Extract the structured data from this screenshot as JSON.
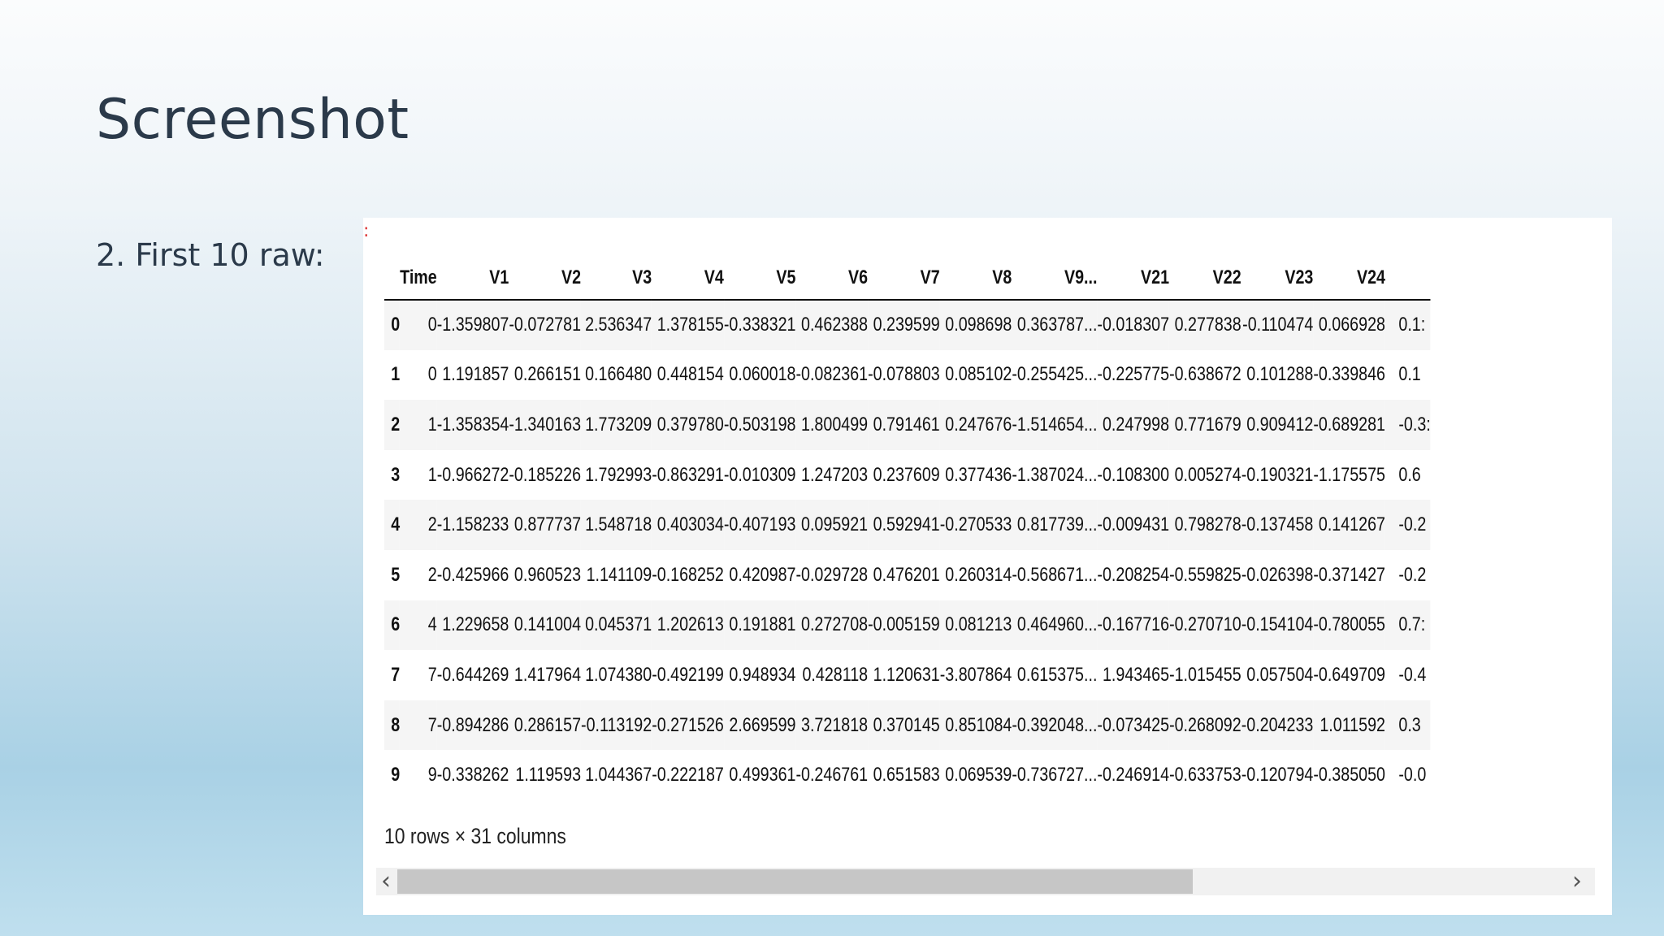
{
  "slide": {
    "title": "Screenshot",
    "subtitle": "2. First 10 raw:"
  },
  "table": {
    "columns": [
      "",
      "Time",
      "V1",
      "V2",
      "V3",
      "V4",
      "V5",
      "V6",
      "V7",
      "V8",
      "V9",
      "...",
      "V21",
      "V22",
      "V23",
      "V24",
      ""
    ],
    "rows": [
      [
        "0",
        "0",
        "-1.359807",
        "-0.072781",
        "2.536347",
        "1.378155",
        "-0.338321",
        "0.462388",
        "0.239599",
        "0.098698",
        "0.363787",
        "...",
        "-0.018307",
        "0.277838",
        "-0.110474",
        "0.066928",
        "0.1:"
      ],
      [
        "1",
        "0",
        "1.191857",
        "0.266151",
        "0.166480",
        "0.448154",
        "0.060018",
        "-0.082361",
        "-0.078803",
        "0.085102",
        "-0.255425",
        "...",
        "-0.225775",
        "-0.638672",
        "0.101288",
        "-0.339846",
        "0.1"
      ],
      [
        "2",
        "1",
        "-1.358354",
        "-1.340163",
        "1.773209",
        "0.379780",
        "-0.503198",
        "1.800499",
        "0.791461",
        "0.247676",
        "-1.514654",
        "...",
        "0.247998",
        "0.771679",
        "0.909412",
        "-0.689281",
        "-0.3:"
      ],
      [
        "3",
        "1",
        "-0.966272",
        "-0.185226",
        "1.792993",
        "-0.863291",
        "-0.010309",
        "1.247203",
        "0.237609",
        "0.377436",
        "-1.387024",
        "...",
        "-0.108300",
        "0.005274",
        "-0.190321",
        "-1.175575",
        "0.6"
      ],
      [
        "4",
        "2",
        "-1.158233",
        "0.877737",
        "1.548718",
        "0.403034",
        "-0.407193",
        "0.095921",
        "0.592941",
        "-0.270533",
        "0.817739",
        "...",
        "-0.009431",
        "0.798278",
        "-0.137458",
        "0.141267",
        "-0.2"
      ],
      [
        "5",
        "2",
        "-0.425966",
        "0.960523",
        "1.141109",
        "-0.168252",
        "0.420987",
        "-0.029728",
        "0.476201",
        "0.260314",
        "-0.568671",
        "...",
        "-0.208254",
        "-0.559825",
        "-0.026398",
        "-0.371427",
        "-0.2"
      ],
      [
        "6",
        "4",
        "1.229658",
        "0.141004",
        "0.045371",
        "1.202613",
        "0.191881",
        "0.272708",
        "-0.005159",
        "0.081213",
        "0.464960",
        "...",
        "-0.167716",
        "-0.270710",
        "-0.154104",
        "-0.780055",
        "0.7:"
      ],
      [
        "7",
        "7",
        "-0.644269",
        "1.417964",
        "1.074380",
        "-0.492199",
        "0.948934",
        "0.428118",
        "1.120631",
        "-3.807864",
        "0.615375",
        "...",
        "1.943465",
        "-1.015455",
        "0.057504",
        "-0.649709",
        "-0.4"
      ],
      [
        "8",
        "7",
        "-0.894286",
        "0.286157",
        "-0.113192",
        "-0.271526",
        "2.669599",
        "3.721818",
        "0.370145",
        "0.851084",
        "-0.392048",
        "...",
        "-0.073425",
        "-0.268092",
        "-0.204233",
        "1.011592",
        "0.3"
      ],
      [
        "9",
        "9",
        "-0.338262",
        "1.119593",
        "1.044367",
        "-0.222187",
        "0.499361",
        "-0.246761",
        "0.651583",
        "0.069539",
        "-0.736727",
        "...",
        "-0.246914",
        "-0.633753",
        "-0.120794",
        "-0.385050",
        "-0.0"
      ]
    ],
    "footer": "10 rows × 31 columns"
  },
  "scrollbar": {
    "left_arrow": "‹",
    "right_arrow": "›",
    "position_fraction": 0.0,
    "visible_fraction": 0.68
  },
  "colors": {
    "marker": "#dd3333"
  },
  "icons": {
    "marker": "colon-marker-icon",
    "scroll_left": "chevron-left-icon",
    "scroll_right": "chevron-right-icon"
  }
}
